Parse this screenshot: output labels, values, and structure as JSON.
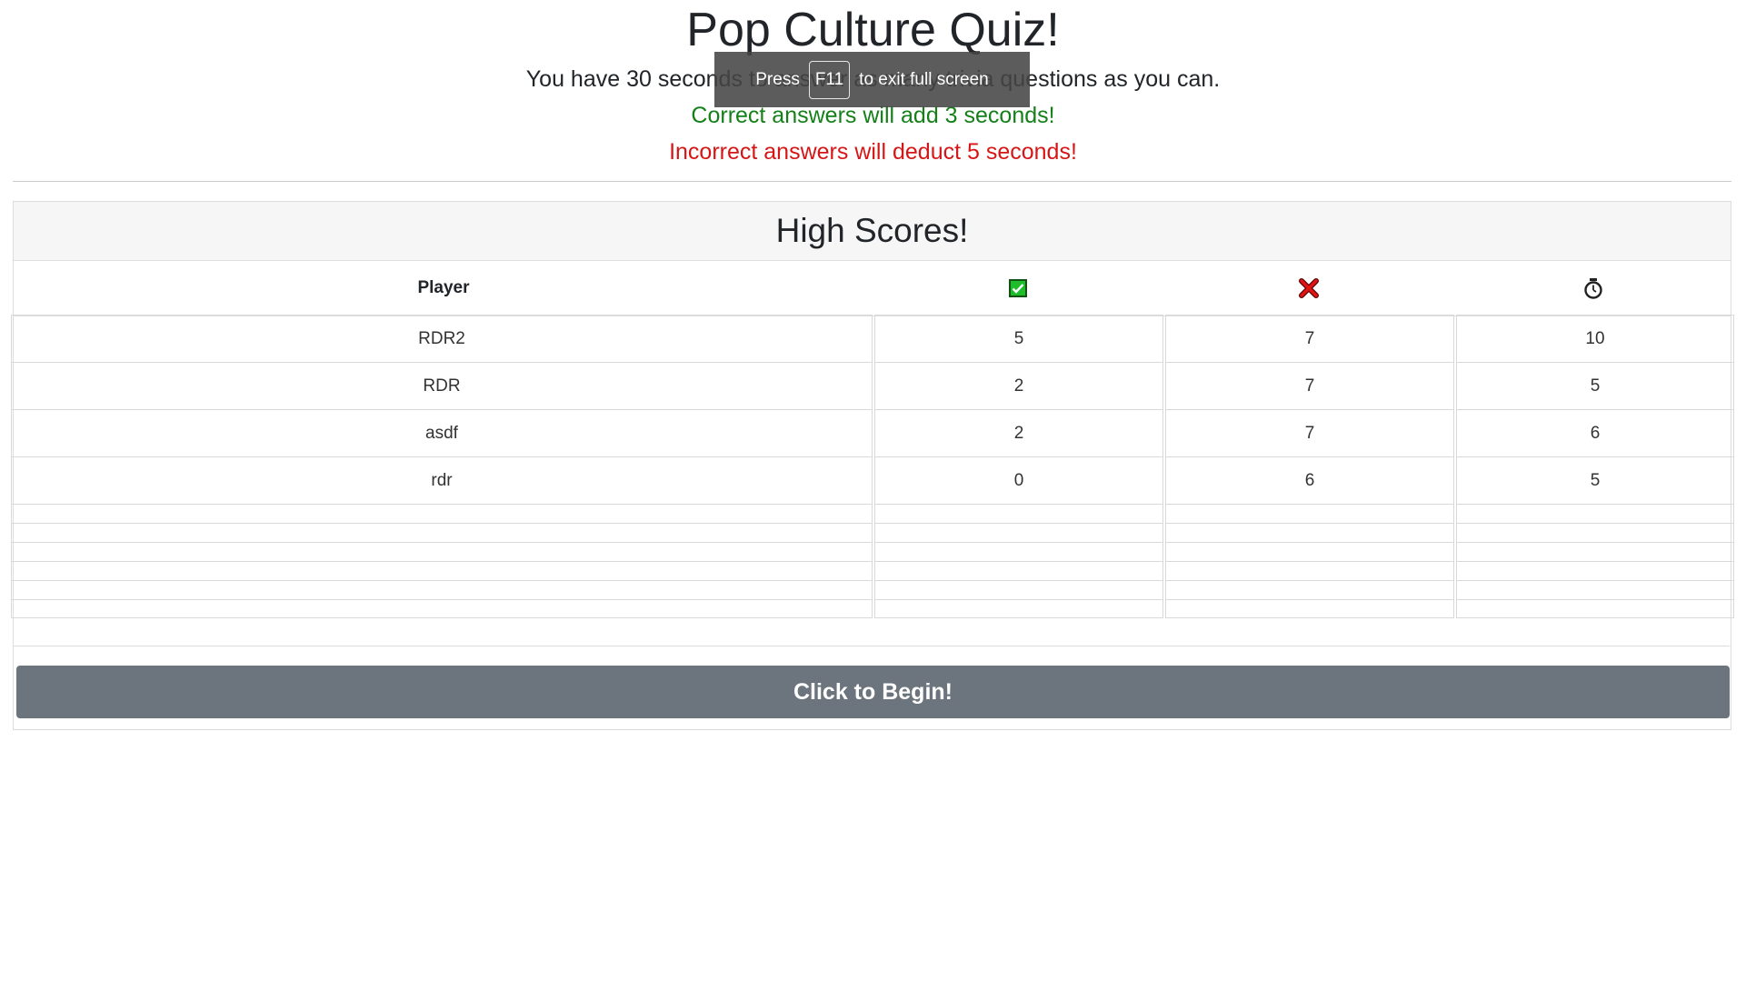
{
  "header": {
    "title": "Pop Culture Quiz!",
    "intro": "You have 30 seconds to answer as many trivia questions as you can.",
    "correct_rule": "Correct answers will add 3 seconds!",
    "incorrect_rule": "Incorrect answers will deduct 5 seconds!"
  },
  "fullscreen_toast": {
    "press": "Press",
    "key": "F11",
    "suffix": "to exit full screen"
  },
  "high_scores": {
    "title": "High Scores!",
    "columns": {
      "player": "Player",
      "correct_icon": "check-mark-icon",
      "incorrect_icon": "cross-mark-icon",
      "time_icon": "stopwatch-icon"
    },
    "rows": [
      {
        "player": "RDR2",
        "correct": "5",
        "incorrect": "7",
        "time": "10"
      },
      {
        "player": "RDR",
        "correct": "2",
        "incorrect": "7",
        "time": "5"
      },
      {
        "player": "asdf",
        "correct": "2",
        "incorrect": "7",
        "time": "6"
      },
      {
        "player": "rdr",
        "correct": "0",
        "incorrect": "6",
        "time": "5"
      }
    ]
  },
  "begin_button": "Click to Begin!",
  "colors": {
    "correct": "#158019",
    "incorrect": "#d61616",
    "button": "#6c757d"
  }
}
